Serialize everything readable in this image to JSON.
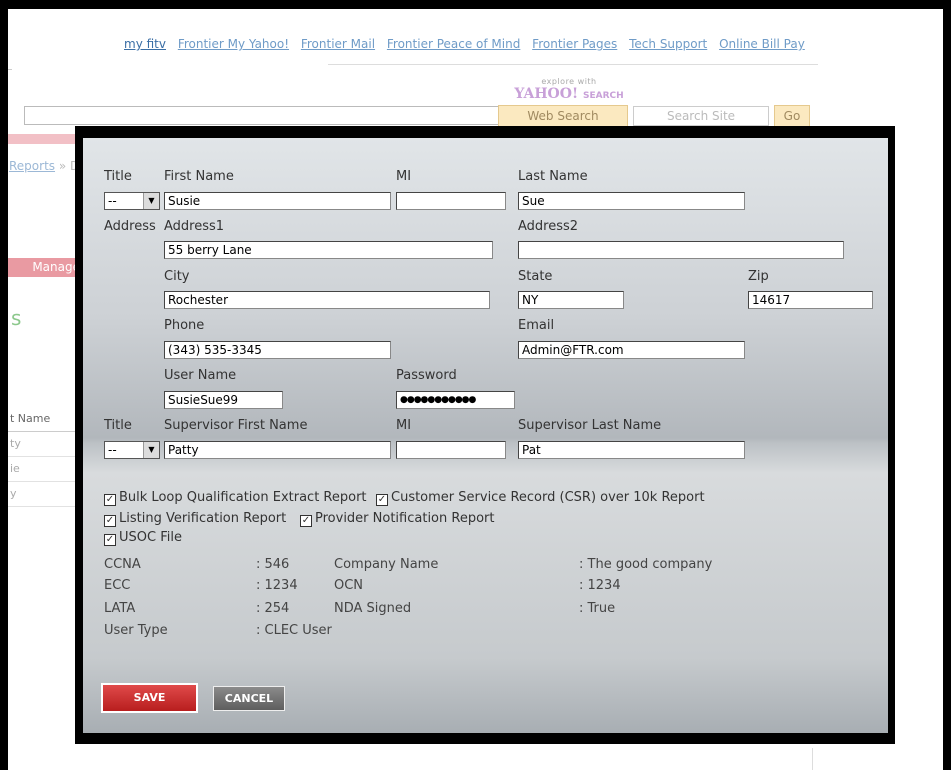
{
  "top_links": [
    "my fitv",
    "Frontier My Yahoo!",
    "Frontier Mail",
    "Frontier Peace of Mind",
    "Frontier Pages",
    "Tech Support",
    "Online Bill Pay"
  ],
  "yahoo": {
    "explore": "explore with",
    "logo": "YAHOO!",
    "search_word": "SEARCH"
  },
  "search": {
    "web_search": "Web Search",
    "site_placeholder": "Search Site",
    "go": "Go"
  },
  "left": {
    "crumb": "Reports",
    "crumb_sep": " » D",
    "manage": "Manage",
    "s_letter": "s",
    "table_header": "t Name",
    "rows": [
      "ty",
      "ie",
      "y"
    ]
  },
  "form": {
    "labels": {
      "title": "Title",
      "first_name": "First Name",
      "mi": "MI",
      "last_name": "Last Name",
      "address": "Address",
      "address1": "Address1",
      "address2": "Address2",
      "city": "City",
      "state": "State",
      "zip": "Zip",
      "phone": "Phone",
      "email": "Email",
      "user_name": "User Name",
      "password": "Password",
      "title2": "Title",
      "sup_first": "Supervisor First Name",
      "mi2": "MI",
      "sup_last": "Supervisor Last Name"
    },
    "values": {
      "title": "--",
      "first_name": "Susie",
      "mi": "",
      "last_name": "Sue",
      "address1": "55 berry Lane",
      "address2": "",
      "city": "Rochester",
      "state": "NY",
      "zip": "14617",
      "phone": "(343) 535-3345",
      "email": "Admin@FTR.com",
      "user_name": "SusieSue99",
      "password": "●●●●●●●●●●●",
      "title2": "--",
      "sup_first": "Patty",
      "mi2": "",
      "sup_last": "Pat"
    }
  },
  "reports": [
    {
      "label": "Bulk Loop Qualification Extract Report",
      "checked": true
    },
    {
      "label": "Customer Service Record (CSR) over 10k Report",
      "checked": true
    },
    {
      "label": "Listing Verification Report",
      "checked": true
    },
    {
      "label": "Provider Notification Report",
      "checked": true
    },
    {
      "label": "USOC File",
      "checked": true
    }
  ],
  "check_mark": "✓",
  "info": {
    "ccna_label": "CCNA",
    "ccna": ": 546",
    "ecc_label": "ECC",
    "ecc": ": 1234",
    "lata_label": "LATA",
    "lata": ": 254",
    "user_type_label": "User Type",
    "user_type": ": CLEC User",
    "company_label": "Company Name",
    "company": ": The good company",
    "ocn_label": "OCN",
    "ocn": ": 1234",
    "nda_label": "NDA Signed",
    "nda": ": True"
  },
  "buttons": {
    "save": "SAVE",
    "cancel": "CANCEL"
  },
  "colors": {
    "link": "#6f9bc7",
    "save": "#c62828",
    "cancel": "#6e6e6e"
  }
}
